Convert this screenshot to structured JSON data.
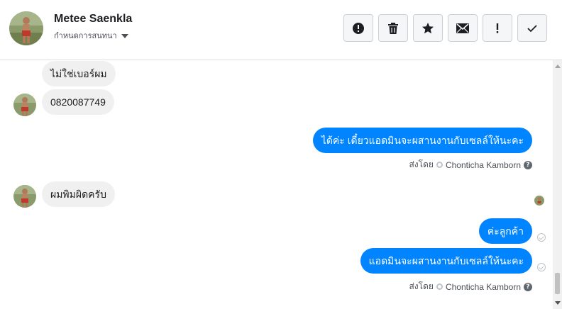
{
  "header": {
    "contact_name": "Metee Saenkla",
    "label_select": "กำหนดการสนทนา"
  },
  "toolbar": {
    "buttons": [
      {
        "name": "mark-spam",
        "icon": "alert-circle-icon"
      },
      {
        "name": "delete",
        "icon": "trash-icon"
      },
      {
        "name": "star",
        "icon": "star-icon"
      },
      {
        "name": "mark-unread",
        "icon": "envelope-icon"
      },
      {
        "name": "follow-up",
        "icon": "exclamation-icon"
      },
      {
        "name": "mark-done",
        "icon": "checkmark-icon"
      }
    ]
  },
  "messages": [
    {
      "from": "customer",
      "text": "ไม่ใช่เบอร์ผม"
    },
    {
      "from": "customer",
      "text": "0820087749"
    },
    {
      "from": "page",
      "text": "ได้ค่ะ เดี๋ยวแอดมินจะผสานงานกับเซลล์ให้นะคะ"
    },
    {
      "from": "customer",
      "text": "ผมพิมผิดครับ"
    },
    {
      "from": "page",
      "text": "ค่ะลูกค้า"
    },
    {
      "from": "page",
      "text": "แอดมินจะผสานงานกับเซลล์ให้นะคะ"
    }
  ],
  "sent_by": {
    "prefix": "ส่งโดย",
    "agent": "Chonticha Kamborn",
    "help": "?"
  },
  "colors": {
    "outgoing_bubble": "#0084ff",
    "incoming_bubble": "#f1f0f0"
  }
}
